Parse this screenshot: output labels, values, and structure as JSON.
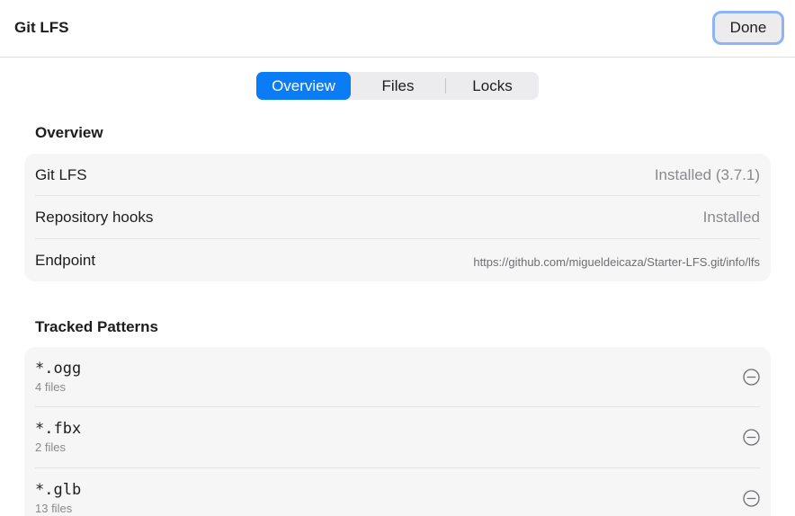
{
  "header": {
    "title": "Git LFS",
    "done_label": "Done"
  },
  "tabs": [
    {
      "label": "Overview",
      "active": true
    },
    {
      "label": "Files",
      "active": false
    },
    {
      "label": "Locks",
      "active": false
    }
  ],
  "overview": {
    "title": "Overview",
    "rows": [
      {
        "label": "Git LFS",
        "value": "Installed (3.7.1)"
      },
      {
        "label": "Repository hooks",
        "value": "Installed"
      },
      {
        "label": "Endpoint",
        "value": "https://github.com/migueldeicaza/Starter-LFS.git/info/lfs"
      }
    ]
  },
  "tracked": {
    "title": "Tracked Patterns",
    "patterns": [
      {
        "pattern": "*.ogg",
        "count": "4 files"
      },
      {
        "pattern": "*.fbx",
        "count": "2 files"
      },
      {
        "pattern": "*.glb",
        "count": "13 files"
      }
    ]
  },
  "colors": {
    "accent": "#0a7cf6",
    "focus_ring": "#8fb4f2",
    "card_background": "#f6f6f6",
    "secondary_text": "#8a8a8e"
  },
  "icons": {
    "remove": "minus-circle-icon"
  }
}
